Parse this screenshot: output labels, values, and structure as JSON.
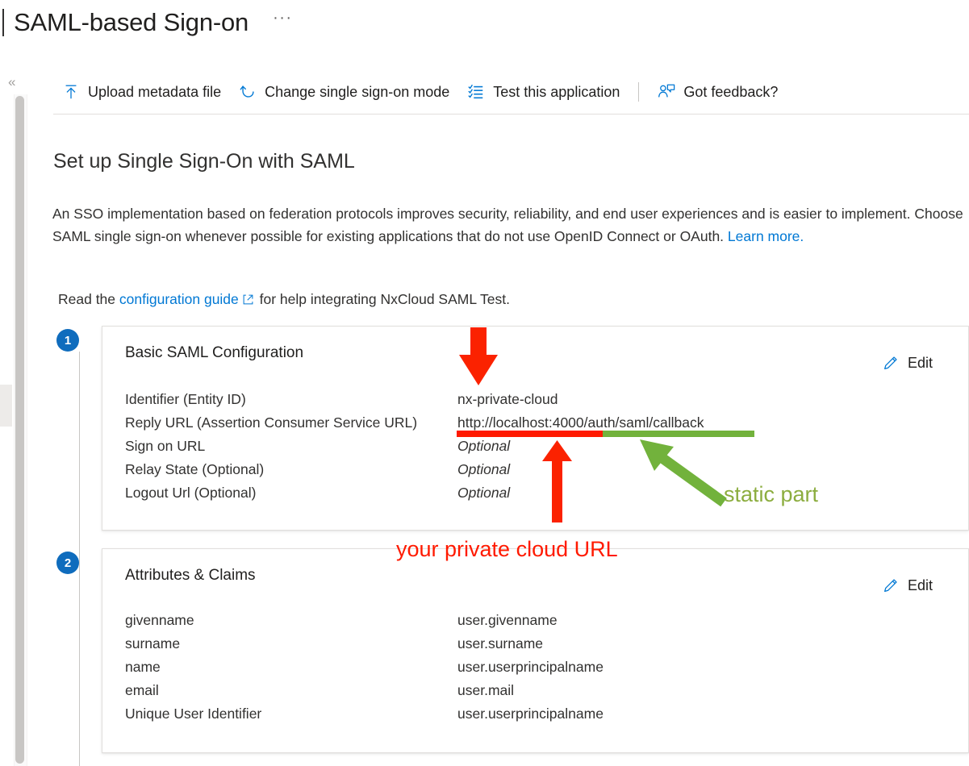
{
  "page": {
    "title": "SAML-based Sign-on",
    "more_actions": "···",
    "collapse_chevron": "«"
  },
  "command_bar": {
    "items": [
      {
        "label": "Upload metadata file",
        "icon": "upload-icon"
      },
      {
        "label": "Change single sign-on mode",
        "icon": "undo-arrow-icon"
      },
      {
        "label": "Test this application",
        "icon": "checklist-icon"
      },
      {
        "label": "Got feedback?",
        "icon": "feedback-person-icon"
      }
    ]
  },
  "content": {
    "heading": "Set up Single Sign-On with SAML",
    "intro_part1": "An SSO implementation based on federation protocols improves security, reliability, and end user experiences and is easier to implement. Choose SAML single sign-on whenever possible for existing applications that do not use OpenID Connect or OAuth. ",
    "intro_link": "Learn more.",
    "guide_prefix": "Read the ",
    "guide_link": "configuration guide",
    "guide_suffix": " for help integrating NxCloud SAML Test."
  },
  "steps": [
    {
      "number": "1"
    },
    {
      "number": "2"
    }
  ],
  "basic_saml_card": {
    "title": "Basic SAML Configuration",
    "edit_label": "Edit",
    "rows": [
      {
        "key": "Identifier (Entity ID)",
        "value": "nx-private-cloud",
        "optional": false
      },
      {
        "key": "Reply URL (Assertion Consumer Service URL)",
        "value": "http://localhost:4000/auth/saml/callback",
        "optional": false
      },
      {
        "key": "Sign on URL",
        "value": "Optional",
        "optional": true
      },
      {
        "key": "Relay State (Optional)",
        "value": "Optional",
        "optional": true
      },
      {
        "key": "Logout Url (Optional)",
        "value": "Optional",
        "optional": true
      }
    ]
  },
  "attributes_card": {
    "title": "Attributes & Claims",
    "edit_label": "Edit",
    "rows": [
      {
        "key": "givenname",
        "value": "user.givenname"
      },
      {
        "key": "surname",
        "value": "user.surname"
      },
      {
        "key": "name",
        "value": "user.userprincipalname"
      },
      {
        "key": "email",
        "value": "user.mail"
      },
      {
        "key": "Unique User Identifier",
        "value": "user.userprincipalname"
      }
    ]
  },
  "annotations": {
    "red_label": "your private cloud URL",
    "green_label": "static part",
    "red_color": "#ff1a00",
    "green_color": "#72b23c",
    "green_text_color": "#8cad3f"
  },
  "colors": {
    "accent": "#0078d4",
    "step_badge": "#0f6cbd",
    "text": "#323130",
    "muted": "#605e5c",
    "border": "#e1dfdd"
  }
}
